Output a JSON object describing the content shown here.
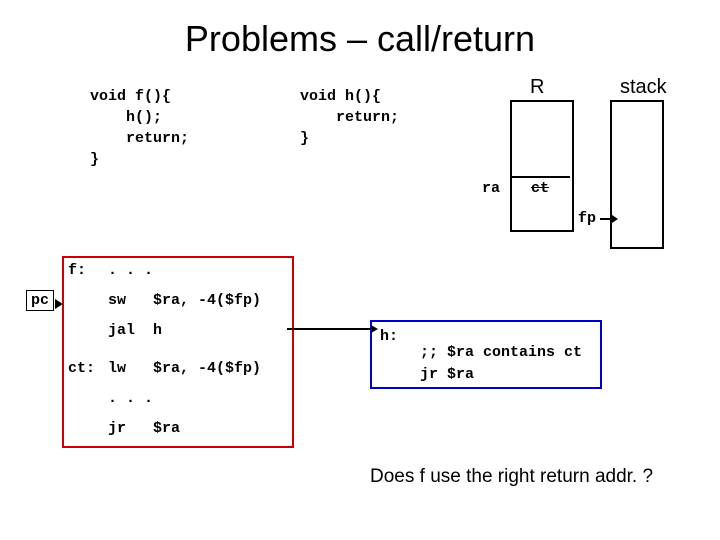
{
  "title": "Problems – call/return",
  "c_code": {
    "f_sig": "void f(){",
    "f_call": "h();",
    "f_ret": "return;",
    "f_close": "}",
    "h_sig": "void h(){",
    "h_ret": "return;",
    "h_close": "}"
  },
  "reg": {
    "title_R": "R",
    "title_stack": "stack",
    "ra_label": "ra",
    "ra_value": "ct",
    "fp_label": "fp"
  },
  "pc_label": "pc",
  "asm": {
    "f_label": "f:",
    "f_dots": ". . .",
    "f_sw": "sw   $ra, -4($fp)",
    "f_jal": "jal  h",
    "ct_label": "ct:",
    "ct_lw": "lw   $ra, -4($fp)",
    "ct_dots": ". . .",
    "ct_jr": "jr   $ra",
    "h_label": "h:",
    "h_cmt": ";; $ra contains ct",
    "h_jr": "jr $ra"
  },
  "question": "Does f use the right return addr. ?"
}
